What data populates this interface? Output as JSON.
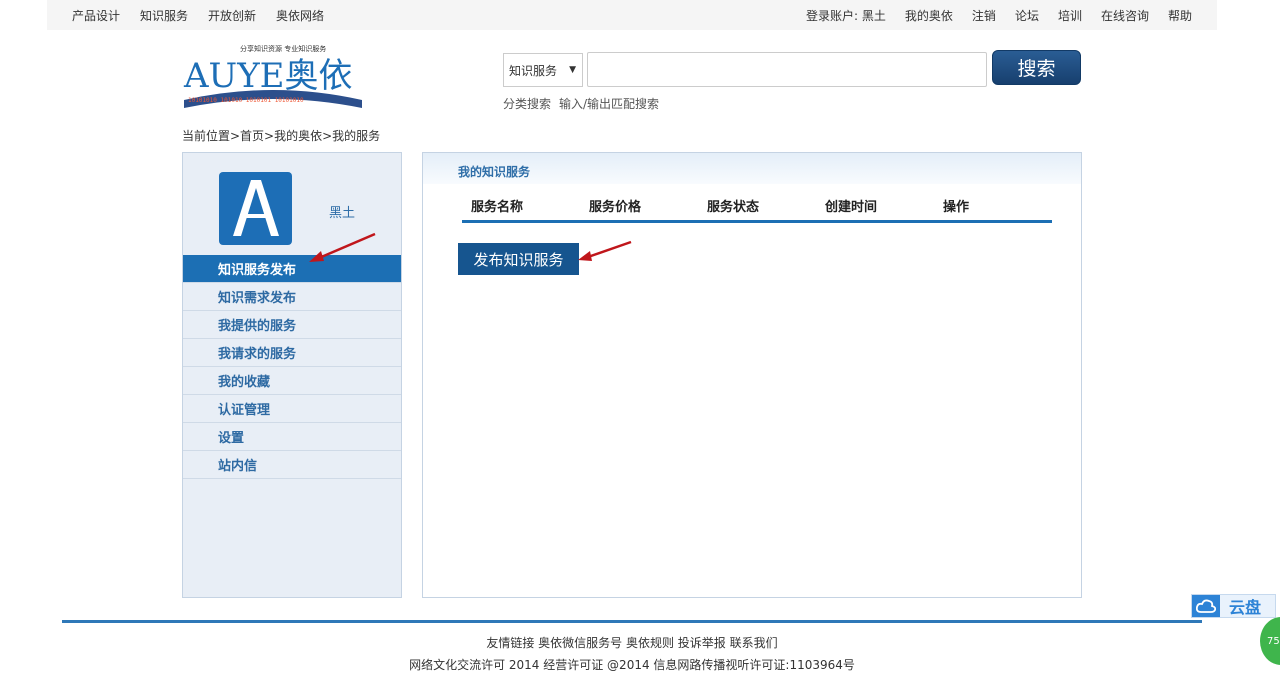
{
  "topnav": {
    "left": [
      "产品设计",
      "知识服务",
      "开放创新",
      "奥依网络"
    ],
    "login_label": "登录账户: 黑土",
    "right": [
      "我的奥依",
      "注销",
      "论坛",
      "培训",
      "在线咨询",
      "帮助"
    ]
  },
  "logo": {
    "text": "AUYE奥依",
    "slogan": "分享知识资源 专业知识服务",
    "binary": "10101010 101010 1010101 10101010"
  },
  "search": {
    "category": "知识服务",
    "value": "",
    "button": "搜索",
    "links": [
      "分类搜索",
      "输入/输出匹配搜索"
    ]
  },
  "breadcrumb": "当前位置>首页>我的奥依>我的服务",
  "user": {
    "name": "黑土"
  },
  "sidebar_menu": [
    "知识服务发布",
    "知识需求发布",
    "我提供的服务",
    "我请求的服务",
    "我的收藏",
    "认证管理",
    "设置",
    "站内信"
  ],
  "panel": {
    "title": "我的知识服务",
    "columns": [
      "服务名称",
      "服务价格",
      "服务状态",
      "创建时间",
      "操作"
    ],
    "publish_button": "发布知识服务"
  },
  "footer": {
    "links": "友情链接 奥依微信服务号 奥依规则 投诉举报 联系我们",
    "license": "网络文化交流许可 2014 经营许可证 @2014 信息网路传播视听许可证:1103964号"
  },
  "cloud_widget": "云盘",
  "badge": "75",
  "colors": {
    "accent": "#1c6fb4",
    "button_dark": "#16558f",
    "arrow": "#c0161b"
  }
}
